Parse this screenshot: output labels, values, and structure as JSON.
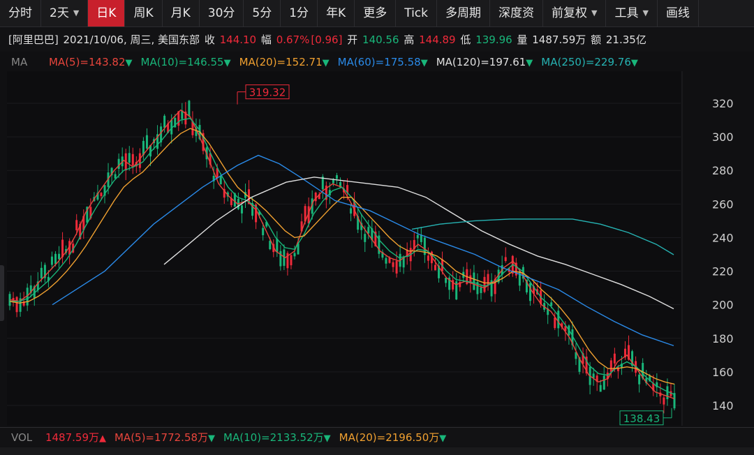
{
  "toolbar": {
    "tabs": [
      {
        "label": "分时",
        "active": false
      },
      {
        "label": "2天",
        "active": false,
        "caret": true
      },
      {
        "label": "日K",
        "active": true
      },
      {
        "label": "周K",
        "active": false
      },
      {
        "label": "月K",
        "active": false
      },
      {
        "label": "30分",
        "active": false
      },
      {
        "label": "5分",
        "active": false
      },
      {
        "label": "1分",
        "active": false
      },
      {
        "label": "年K",
        "active": false
      },
      {
        "label": "更多",
        "active": false
      },
      {
        "label": "Tick",
        "active": false
      },
      {
        "label": "多周期",
        "active": false
      },
      {
        "label": "深度资",
        "active": false
      },
      {
        "label": "前复权",
        "active": false,
        "caret": true
      },
      {
        "label": "工具",
        "active": false,
        "caret": true
      },
      {
        "label": "画线",
        "active": false
      }
    ]
  },
  "info": {
    "name": "[阿里巴巴]",
    "date": "2021/10/06, 周三, 美国东部",
    "close_label": "收",
    "close": "144.10",
    "change_label": "幅",
    "change": "0.67%",
    "change_abs": "[0.96]",
    "open_label": "开",
    "open": "140.56",
    "high_label": "高",
    "high": "144.89",
    "low_label": "低",
    "low": "139.96",
    "volume_label": "量",
    "volume": "1487.59万",
    "amount_label": "额",
    "amount": "21.35亿"
  },
  "ma": {
    "label": "MA",
    "items": [
      {
        "text": "MA(5)=143.82",
        "color": "#e8453c",
        "dir": "down"
      },
      {
        "text": "MA(10)=146.55",
        "color": "#19b67a",
        "dir": "down"
      },
      {
        "text": "MA(20)=152.71",
        "color": "#f0a030",
        "dir": "down"
      },
      {
        "text": "MA(60)=175.58",
        "color": "#2a8ae8",
        "dir": "down"
      },
      {
        "text": "MA(120)=197.61",
        "color": "#e0e0e0",
        "dir": "down"
      },
      {
        "text": "MA(250)=229.76",
        "color": "#26b3b3",
        "dir": "down"
      }
    ]
  },
  "vol": {
    "label": "VOL",
    "items": [
      {
        "text": "1487.59万",
        "color": "#f02a3a",
        "dir": "up"
      },
      {
        "text": "MA(5)=1772.58万",
        "color": "#e8453c",
        "dir": "down"
      },
      {
        "text": "MA(10)=2133.52万",
        "color": "#19b67a",
        "dir": "down"
      },
      {
        "text": "MA(20)=2196.50万",
        "color": "#f0a030",
        "dir": "down"
      }
    ]
  },
  "chart_data": {
    "type": "line",
    "title": "",
    "xlabel": "",
    "ylabel": "",
    "ylim": [
      128,
      330
    ],
    "y_ticks": [
      "320",
      "300",
      "280",
      "260",
      "240",
      "220",
      "200",
      "180",
      "160",
      "140"
    ],
    "high_annotation": "319.32",
    "low_annotation": "138.43",
    "colors": {
      "up": "#f02a3a",
      "down": "#19b67a",
      "grid": "#1e1e22"
    },
    "series": [
      {
        "name": "MA(5)",
        "color": "#e8453c",
        "values": [
          203,
          202,
          206,
          213,
          219,
          225,
          232,
          242,
          255,
          264,
          272,
          280,
          286,
          282,
          289,
          296,
          303,
          310,
          316,
          312,
          300,
          286,
          272,
          265,
          260,
          262,
          256,
          244,
          232,
          228,
          232,
          248,
          262,
          268,
          272,
          270,
          260,
          248,
          240,
          232,
          228,
          226,
          230,
          236,
          232,
          224,
          216,
          212,
          214,
          212,
          210,
          214,
          222,
          226,
          218,
          208,
          200,
          196,
          188,
          180,
          168,
          158,
          154,
          156,
          166,
          170,
          162,
          154,
          148,
          146,
          144
        ]
      },
      {
        "name": "MA(10)",
        "color": "#19b67a",
        "values": [
          202,
          202,
          204,
          209,
          214,
          220,
          227,
          236,
          247,
          257,
          266,
          274,
          280,
          282,
          285,
          292,
          298,
          305,
          310,
          311,
          304,
          292,
          280,
          270,
          264,
          262,
          258,
          250,
          240,
          234,
          233,
          242,
          254,
          262,
          268,
          270,
          264,
          254,
          246,
          238,
          232,
          228,
          229,
          233,
          232,
          227,
          220,
          215,
          214,
          213,
          211,
          213,
          219,
          224,
          220,
          212,
          204,
          199,
          192,
          184,
          174,
          164,
          159,
          158,
          163,
          166,
          163,
          157,
          152,
          149,
          146.5
        ]
      },
      {
        "name": "MA(20)",
        "color": "#f0a030",
        "values": [
          202,
          201,
          202,
          205,
          209,
          214,
          220,
          227,
          235,
          244,
          253,
          262,
          270,
          275,
          279,
          285,
          291,
          297,
          302,
          305,
          303,
          296,
          287,
          278,
          270,
          265,
          261,
          256,
          250,
          244,
          240,
          241,
          247,
          253,
          259,
          264,
          264,
          258,
          252,
          246,
          240,
          235,
          232,
          232,
          231,
          229,
          225,
          220,
          217,
          215,
          213,
          213,
          216,
          220,
          219,
          215,
          209,
          204,
          198,
          191,
          182,
          173,
          166,
          162,
          162,
          163,
          162,
          159,
          156,
          154,
          152.7
        ]
      },
      {
        "name": "MA(60)",
        "color": "#2a8ae8",
        "values": [
          [
            75,
            200
          ],
          [
            150,
            220
          ],
          [
            220,
            248
          ],
          [
            290,
            270
          ],
          [
            340,
            283
          ],
          [
            370,
            289
          ],
          [
            400,
            284
          ],
          [
            430,
            276
          ],
          [
            480,
            262
          ],
          [
            530,
            256
          ],
          [
            560,
            250
          ],
          [
            600,
            242
          ],
          [
            640,
            236
          ],
          [
            680,
            230
          ],
          [
            720,
            222
          ],
          [
            770,
            214
          ],
          [
            800,
            209
          ],
          [
            840,
            199
          ],
          [
            880,
            190
          ],
          [
            920,
            182
          ],
          [
            965,
            175.6
          ]
        ]
      },
      {
        "name": "MA(120)",
        "color": "#e0e0e0",
        "values": [
          [
            235,
            224
          ],
          [
            270,
            236
          ],
          [
            310,
            250
          ],
          [
            360,
            264
          ],
          [
            410,
            273
          ],
          [
            450,
            276
          ],
          [
            490,
            274
          ],
          [
            530,
            272
          ],
          [
            570,
            270
          ],
          [
            610,
            264
          ],
          [
            650,
            254
          ],
          [
            690,
            244
          ],
          [
            730,
            236
          ],
          [
            770,
            229
          ],
          [
            810,
            224
          ],
          [
            850,
            218
          ],
          [
            890,
            212
          ],
          [
            930,
            205
          ],
          [
            965,
            197.6
          ]
        ]
      },
      {
        "name": "MA(250)",
        "color": "#26b3b3",
        "values": [
          [
            590,
            245
          ],
          [
            630,
            248
          ],
          [
            680,
            250
          ],
          [
            730,
            251
          ],
          [
            780,
            251
          ],
          [
            820,
            251
          ],
          [
            860,
            248
          ],
          [
            900,
            243
          ],
          [
            940,
            236
          ],
          [
            965,
            229.8
          ]
        ]
      }
    ]
  }
}
